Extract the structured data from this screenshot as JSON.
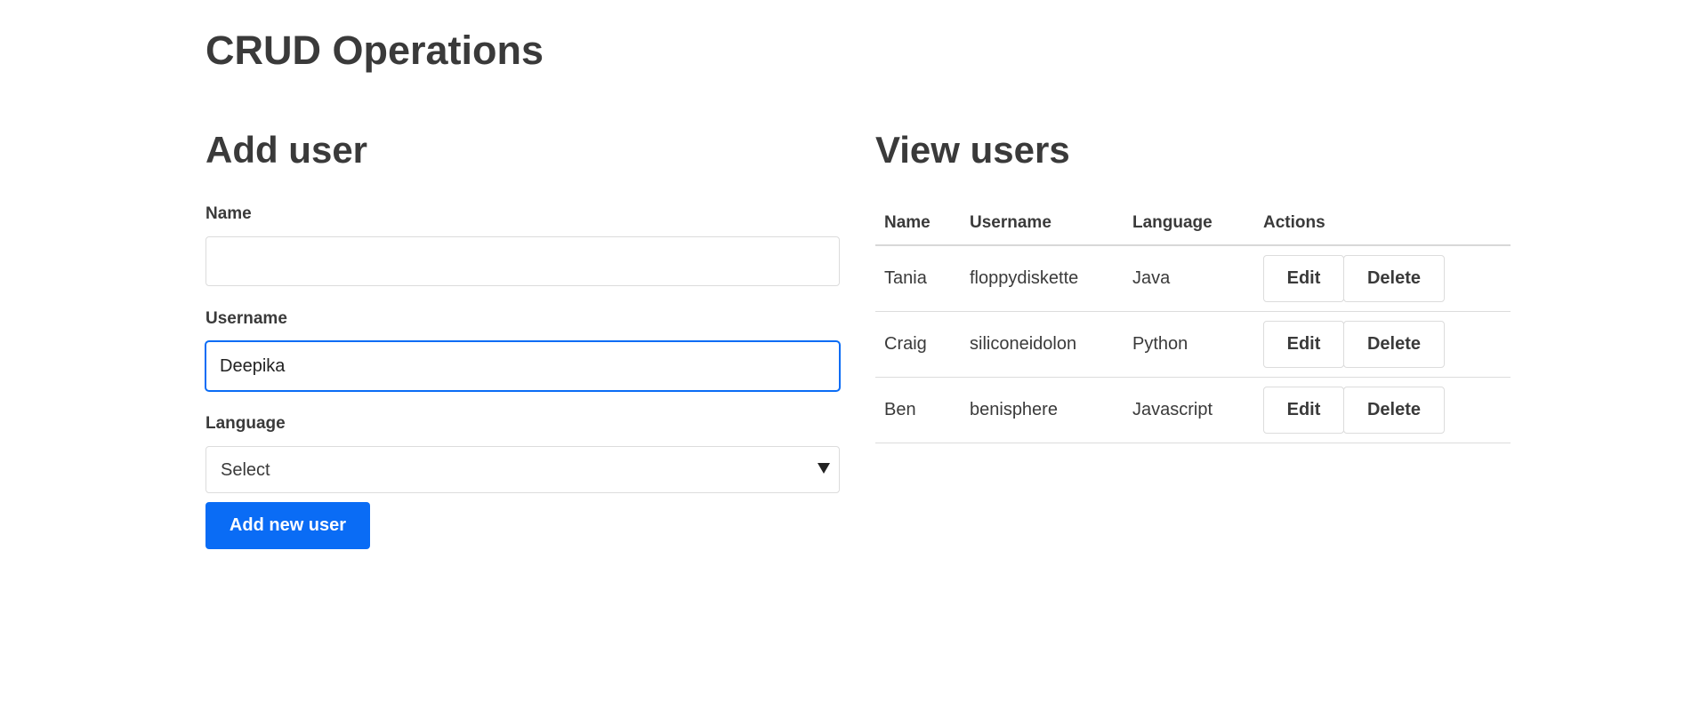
{
  "page": {
    "title": "CRUD Operations"
  },
  "add_user": {
    "title": "Add user",
    "name_label": "Name",
    "name_value": "",
    "username_label": "Username",
    "username_value": "Deepika",
    "language_label": "Language",
    "language_selected": "Select",
    "submit_label": "Add new user"
  },
  "view_users": {
    "title": "View users",
    "columns": [
      "Name",
      "Username",
      "Language",
      "Actions"
    ],
    "rows": [
      {
        "name": "Tania",
        "username": "floppydiskette",
        "language": "Java",
        "edit_label": "Edit",
        "delete_label": "Delete"
      },
      {
        "name": "Craig",
        "username": "siliconeidolon",
        "language": "Python",
        "edit_label": "Edit",
        "delete_label": "Delete"
      },
      {
        "name": "Ben",
        "username": "benisphere",
        "language": "Javascript",
        "edit_label": "Edit",
        "delete_label": "Delete"
      }
    ]
  },
  "colors": {
    "accent": "#0a6cf5",
    "text": "#3a3a3a",
    "border": "#dcdcdc"
  },
  "icons": {
    "select_caret": "caret-down-icon"
  }
}
